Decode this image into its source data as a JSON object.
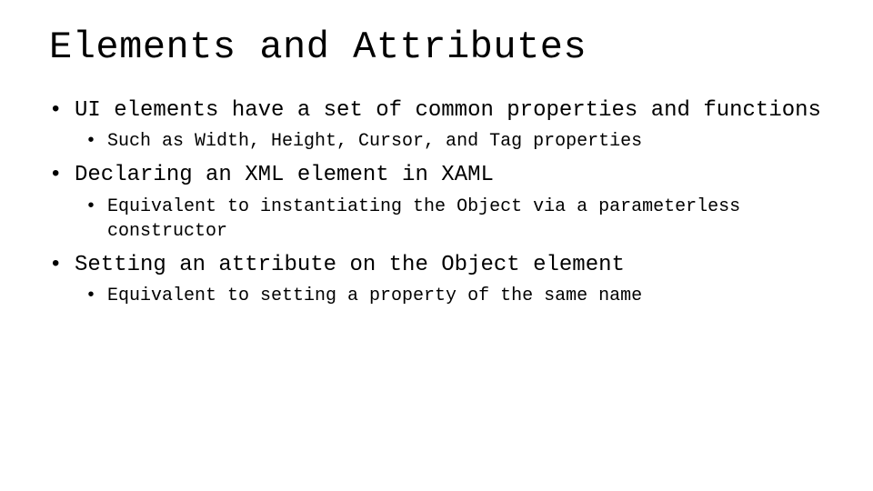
{
  "slide": {
    "title": "Elements and Attributes",
    "bullets": [
      {
        "text": "UI elements have a set of common properties and functions",
        "children": [
          {
            "text": "Such as Width, Height, Cursor, and Tag properties"
          }
        ]
      },
      {
        "text": "Declaring an XML element in XAML",
        "children": [
          {
            "text": "Equivalent to instantiating the Object via a parameterless constructor"
          }
        ]
      },
      {
        "text": "Setting an attribute on the Object element",
        "children": [
          {
            "text": "Equivalent to setting a property of the same name"
          }
        ]
      }
    ]
  }
}
